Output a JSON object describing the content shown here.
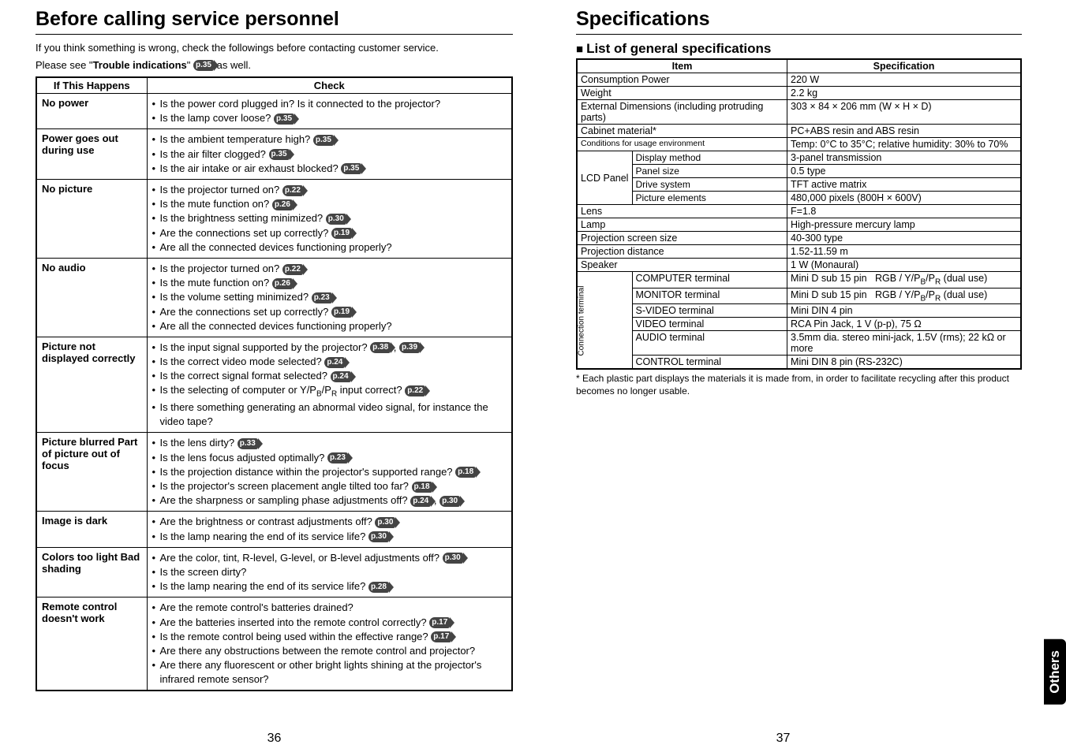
{
  "left": {
    "h1": "Before calling service personnel",
    "intro1": "If you think something is wrong, check the followings before contacting customer service.",
    "intro2a": "Please see \"",
    "intro2b": "Trouble indications",
    "intro2c": "\" ",
    "intro2ref": "p.35",
    "intro2d": " as well.",
    "header_if": "If  This Happens",
    "header_check": "Check",
    "rows": [
      {
        "if": "No power",
        "items": [
          {
            "text": "Is the power cord plugged in? Is it connected to the projector?",
            "refs": []
          },
          {
            "text": "Is the lamp cover loose? ",
            "refs": [
              "p.35"
            ]
          }
        ]
      },
      {
        "if": "Power goes out during use",
        "items": [
          {
            "text": "Is the ambient temperature high? ",
            "refs": [
              "p.35"
            ]
          },
          {
            "text": "Is the air filter clogged? ",
            "refs": [
              "p.35"
            ]
          },
          {
            "text": "Is the air intake or air exhaust blocked? ",
            "refs": [
              "p.35"
            ]
          }
        ]
      },
      {
        "if": "No picture",
        "items": [
          {
            "text": "Is the projector turned on? ",
            "refs": [
              "p.22"
            ]
          },
          {
            "text": "Is the mute function on? ",
            "refs": [
              "p.26"
            ]
          },
          {
            "text": "Is the brightness setting minimized? ",
            "refs": [
              "p.30"
            ]
          },
          {
            "text": "Are the connections set up correctly? ",
            "refs": [
              "p.19"
            ]
          },
          {
            "text": "Are all the connected devices functioning properly?",
            "refs": []
          }
        ]
      },
      {
        "if": "No audio",
        "items": [
          {
            "text": "Is the projector turned on? ",
            "refs": [
              "p.22"
            ]
          },
          {
            "text": "Is the mute function on? ",
            "refs": [
              "p.26"
            ]
          },
          {
            "text": "Is the volume setting minimized? ",
            "refs": [
              "p.23"
            ]
          },
          {
            "text": "Are the connections set up correctly? ",
            "refs": [
              "p.19"
            ]
          },
          {
            "text": "Are all the connected devices functioning properly?",
            "refs": []
          }
        ]
      },
      {
        "if": "Picture not displayed correctly",
        "items": [
          {
            "text": "Is the input signal supported by the projector? ",
            "refs": [
              "p.38",
              "p.39"
            ]
          },
          {
            "text": "Is the correct video mode selected? ",
            "refs": [
              "p.24"
            ]
          },
          {
            "text": "Is the correct signal format selected?  ",
            "refs": [
              "p.24"
            ]
          },
          {
            "text_html": "Is the selecting of computer or Y/P<span class='sub'>B</span>/P<span class='sub'>R</span> input correct? ",
            "refs": [
              "p.22"
            ]
          },
          {
            "text": "Is there something generating an abnormal video signal, for instance the video tape?",
            "refs": []
          }
        ]
      },
      {
        "if": "Picture blurred Part of picture out of focus",
        "items": [
          {
            "text": "Is the lens dirty? ",
            "refs": [
              "p.33"
            ]
          },
          {
            "text": "Is the lens focus adjusted optimally? ",
            "refs": [
              "p.23"
            ]
          },
          {
            "text": "Is the projection distance within the projector's supported range? ",
            "refs": [
              "p.18"
            ]
          },
          {
            "text": "Is the projector's screen placement angle tilted too far?   ",
            "refs": [
              "p.18"
            ]
          },
          {
            "text": "Are the sharpness or sampling phase adjustments off? ",
            "refs": [
              "p.24",
              "p.30"
            ]
          }
        ]
      },
      {
        "if": "Image is dark",
        "items": [
          {
            "text": "Are the brightness or contrast adjustments off? ",
            "refs": [
              "p.30"
            ]
          },
          {
            "text": "Is the lamp nearing the end of its service life? ",
            "refs": [
              "p.30"
            ]
          }
        ]
      },
      {
        "if": "Colors too light Bad shading",
        "items": [
          {
            "text": "Are the color, tint, R-level, G-level, or B-level adjustments off? ",
            "refs": [
              "p.30"
            ]
          },
          {
            "text": "Is the screen dirty?",
            "refs": []
          },
          {
            "text": "Is the lamp nearing the end of its service life? ",
            "refs": [
              "p.28"
            ]
          }
        ]
      },
      {
        "if": "Remote control doesn't work",
        "items": [
          {
            "text": "Are the remote control's batteries drained?",
            "refs": []
          },
          {
            "text": "Are the batteries inserted into the remote control correctly? ",
            "refs": [
              "p.17"
            ]
          },
          {
            "text": "Is the remote control being used within the effective range? ",
            "refs": [
              "p.17"
            ]
          },
          {
            "text": "Are there any obstructions between the remote control and projector?",
            "refs": []
          },
          {
            "text": "Are there any fluorescent or other bright lights shining at the projector's infrared remote sensor?",
            "refs": []
          }
        ]
      }
    ],
    "page_num": "36"
  },
  "right": {
    "h1": "Specifications",
    "subhead": "List of general specifications",
    "header_item": "Item",
    "header_spec": "Specification",
    "lcd_label": "LCD Panel",
    "conn_label": "Connection terminal",
    "rows_simple": [
      {
        "item": "Consumption Power",
        "spec": "220 W"
      },
      {
        "item": "Weight",
        "spec": "2.2 kg"
      },
      {
        "item": "External Dimensions (including protruding parts)",
        "spec": "303 × 84 × 206 mm (W × H × D)"
      },
      {
        "item": "Cabinet material*",
        "spec": "PC+ABS resin and ABS resin"
      },
      {
        "item": "Conditions for usage environment",
        "spec": "Temp: 0°C to 35°C; relative humidity: 30% to 70%"
      }
    ],
    "lcd_rows": [
      {
        "sub": "Display method",
        "spec": "3-panel transmission"
      },
      {
        "sub": "Panel size",
        "spec": "0.5 type"
      },
      {
        "sub": "Drive system",
        "spec": "TFT active matrix"
      },
      {
        "sub": "Picture elements",
        "spec": "480,000 pixels (800H × 600V)"
      }
    ],
    "rows_after_lcd": [
      {
        "item": "Lens",
        "spec": "F=1.8"
      },
      {
        "item": "Lamp",
        "spec": "High-pressure mercury lamp"
      },
      {
        "item": "Projection screen size",
        "spec": "40-300 type"
      },
      {
        "item": "Projection distance",
        "spec": "1.52-11.59 m"
      },
      {
        "item": "Speaker",
        "spec": "1 W (Monaural)"
      }
    ],
    "conn_rows": [
      {
        "sub": "COMPUTER terminal",
        "spec_html": "Mini D sub 15 pin&nbsp;&nbsp; RGB / Y/P<span class='sub'>B</span>/P<span class='sub'>R</span> (dual use)"
      },
      {
        "sub": "MONITOR terminal",
        "spec_html": "Mini D sub 15 pin&nbsp;&nbsp; RGB / Y/P<span class='sub'>B</span>/P<span class='sub'>R</span> (dual use)"
      },
      {
        "sub": "S-VIDEO terminal",
        "spec": "Mini DIN 4 pin"
      },
      {
        "sub": "VIDEO terminal",
        "spec": "RCA Pin Jack, 1 V (p-p), 75 Ω"
      },
      {
        "sub": "AUDIO terminal",
        "spec": "3.5mm dia. stereo mini-jack, 1.5V (rms); 22 kΩ or more"
      },
      {
        "sub": "CONTROL terminal",
        "spec": "Mini DIN 8 pin (RS-232C)"
      }
    ],
    "footnote": "* Each plastic part displays the materials it is made from, in order to facilitate recycling after this product becomes no longer usable.",
    "side_tab": "Others",
    "page_num": "37"
  },
  "chart_data": {
    "type": "table",
    "title": "Projector manual pages 36–37",
    "tables": [
      {
        "name": "Troubleshooting (Before calling service personnel)",
        "columns": [
          "If This Happens",
          "Check (bullet items with page refs)"
        ],
        "rows": [
          [
            "No power",
            "Is the power cord plugged in? Is it connected to the projector?; Is the lamp cover loose? [p.35]"
          ],
          [
            "Power goes out during use",
            "Is the ambient temperature high? [p.35]; Is the air filter clogged? [p.35]; Is the air intake or air exhaust blocked? [p.35]"
          ],
          [
            "No picture",
            "Is the projector turned on? [p.22]; Is the mute function on? [p.26]; Is the brightness setting minimized? [p.30]; Are the connections set up correctly? [p.19]; Are all the connected devices functioning properly?"
          ],
          [
            "No audio",
            "Is the projector turned on? [p.22]; Is the mute function on? [p.26]; Is the volume setting minimized? [p.23]; Are the connections set up correctly? [p.19]; Are all the connected devices functioning properly?"
          ],
          [
            "Picture not displayed correctly",
            "Is the input signal supported by the projector? [p.38,p.39]; Is the correct video mode selected? [p.24]; Is the correct signal format selected? [p.24]; Is the selecting of computer or Y/PB/PR input correct? [p.22]; Is there something generating an abnormal video signal, for instance the video tape?"
          ],
          [
            "Picture blurred / Part of picture out of focus",
            "Is the lens dirty? [p.33]; Is the lens focus adjusted optimally? [p.23]; Is the projection distance within the projector's supported range? [p.18]; Is the projector's screen placement angle tilted too far? [p.18]; Are the sharpness or sampling phase adjustments off? [p.24,p.30]"
          ],
          [
            "Image is dark",
            "Are the brightness or contrast adjustments off? [p.30]; Is the lamp nearing the end of its service life? [p.30]"
          ],
          [
            "Colors too light / Bad shading",
            "Are the color, tint, R-level, G-level, or B-level adjustments off? [p.30]; Is the screen dirty?; Is the lamp nearing the end of its service life? [p.28]"
          ],
          [
            "Remote control doesn't work",
            "Are the remote control's batteries drained?; Are the batteries inserted into the remote control correctly? [p.17]; Is the remote control being used within the effective range? [p.17]; Are there any obstructions between the remote control and projector?; Are there any fluorescent or other bright lights shining at the projector's infrared remote sensor?"
          ]
        ]
      },
      {
        "name": "Specifications — List of general specifications",
        "columns": [
          "Item",
          "Specification"
        ],
        "rows": [
          [
            "Consumption Power",
            "220 W"
          ],
          [
            "Weight",
            "2.2 kg"
          ],
          [
            "External Dimensions (including protruding parts)",
            "303 × 84 × 206 mm (W × H × D)"
          ],
          [
            "Cabinet material*",
            "PC+ABS resin and ABS resin"
          ],
          [
            "Conditions for usage environment",
            "Temp: 0°C to 35°C; relative humidity: 30% to 70%"
          ],
          [
            "LCD Panel — Display method",
            "3-panel transmission"
          ],
          [
            "LCD Panel — Panel size",
            "0.5 type"
          ],
          [
            "LCD Panel — Drive system",
            "TFT active matrix"
          ],
          [
            "LCD Panel — Picture elements",
            "480,000 pixels (800H × 600V)"
          ],
          [
            "Lens",
            "F=1.8"
          ],
          [
            "Lamp",
            "High-pressure mercury lamp"
          ],
          [
            "Projection screen size",
            "40-300 type"
          ],
          [
            "Projection distance",
            "1.52-11.59 m"
          ],
          [
            "Speaker",
            "1 W (Monaural)"
          ],
          [
            "Connection terminal — COMPUTER terminal",
            "Mini D sub 15 pin  RGB / Y/PB/PR (dual use)"
          ],
          [
            "Connection terminal — MONITOR terminal",
            "Mini D sub 15 pin  RGB / Y/PB/PR (dual use)"
          ],
          [
            "Connection terminal — S-VIDEO terminal",
            "Mini DIN 4 pin"
          ],
          [
            "Connection terminal — VIDEO terminal",
            "RCA Pin Jack, 1 V (p-p), 75 Ω"
          ],
          [
            "Connection terminal — AUDIO terminal",
            "3.5mm dia. stereo mini-jack, 1.5V (rms); 22 kΩ or more"
          ],
          [
            "Connection terminal — CONTROL terminal",
            "Mini DIN 8 pin (RS-232C)"
          ]
        ]
      }
    ]
  }
}
